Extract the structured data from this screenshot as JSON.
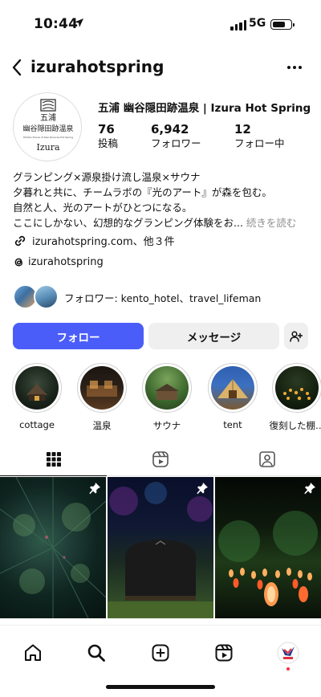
{
  "status_bar": {
    "time": "10:44",
    "network": "5G"
  },
  "header": {
    "username": "izurahotspring"
  },
  "profile": {
    "display_name": "五浦 幽谷隠田跡温泉 | Izura Hot Spring",
    "avatar_logo": {
      "line1": "五浦",
      "line2": "幽谷隠田跡温泉",
      "line3": "Hidden Traces of Kiss Terraces Hot Spring",
      "line4": "Izura"
    },
    "stats": [
      {
        "value": "76",
        "label": "投稿"
      },
      {
        "value": "6,942",
        "label": "フォロワー"
      },
      {
        "value": "12",
        "label": "フォロー中"
      }
    ]
  },
  "bio": {
    "lines": [
      "グランピング×源泉掛け流し温泉×サウナ",
      "夕暮れと共に、チームラボの『光のアート』が森を包む。",
      "自然と人、光のアートがひとつになる。",
      "ここにしかない、幻想的なグランピング体験をお..."
    ],
    "more_label": "続きを読む",
    "link": "izurahotspring.com、他３件",
    "threads_handle": "izurahotspring"
  },
  "followers": {
    "text": "フォロワー: kento_hotel、travel_lifeman"
  },
  "buttons": {
    "follow": "フォロー",
    "message": "メッセージ"
  },
  "highlights": [
    {
      "label": "cottage"
    },
    {
      "label": "温泉"
    },
    {
      "label": "サウナ"
    },
    {
      "label": "tent"
    },
    {
      "label": "復刻した棚…"
    }
  ],
  "tabs": [
    "grid-icon",
    "reels-icon",
    "tagged-icon"
  ],
  "nav": [
    "home-icon",
    "search-icon",
    "create-icon",
    "reels-icon",
    "profile-avatar"
  ],
  "colors": {
    "follow_button": "#4a5df9",
    "secondary_button": "#efefef",
    "muted_text": "#8e8e8e"
  }
}
